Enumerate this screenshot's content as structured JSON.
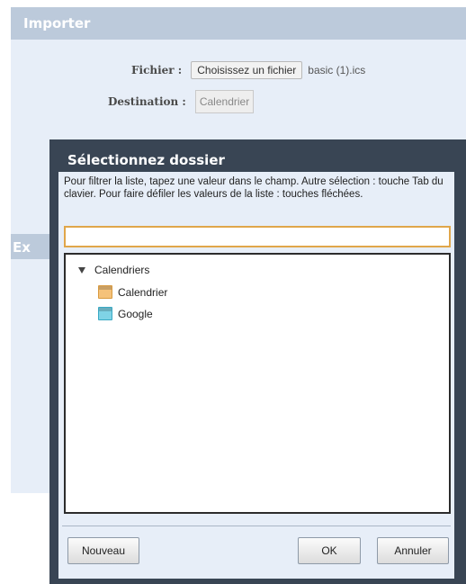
{
  "importer": {
    "title": "Importer",
    "file_label": "Fichier :",
    "file_button": "Choisissez un fichier",
    "file_name": "basic (1).ics",
    "destination_label": "Destination :",
    "destination_value": "Calendrier"
  },
  "exporter": {
    "title_fragment": "Ex"
  },
  "dialog": {
    "title": "Sélectionnez dossier",
    "hint": "Pour filtrer la liste, tapez une valeur dans le champ. Autre sélection : touche Tab du clavier. Pour faire défiler les valeurs de la liste : touches fléchées.",
    "filter_value": "",
    "tree": {
      "root_label": "Calendriers",
      "items": [
        {
          "label": "Calendrier",
          "icon": "calendar-icon",
          "color": "#f5c27a"
        },
        {
          "label": "Google",
          "icon": "calendar-icon",
          "color": "#7fd3e6"
        }
      ]
    },
    "buttons": {
      "new": "Nouveau",
      "ok": "OK",
      "cancel": "Annuler"
    }
  },
  "colors": {
    "dialog_frame": "#394554",
    "panel_bg": "#e7eef8",
    "header_bg": "#bccadb",
    "input_focus": "#e0a64a"
  }
}
